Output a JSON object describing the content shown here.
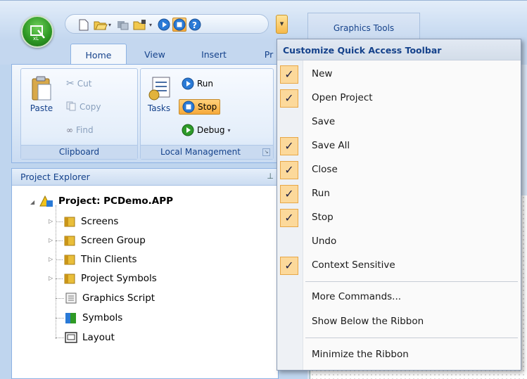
{
  "context_tab": "Graphics Tools",
  "ribbon": {
    "tabs": [
      {
        "label": "Home",
        "active": true
      },
      {
        "label": "View",
        "active": false
      },
      {
        "label": "Insert",
        "active": false
      },
      {
        "label": "Pr",
        "active": false
      }
    ],
    "clipboard": {
      "paste": "Paste",
      "cut": "Cut",
      "copy": "Copy",
      "find": "Find",
      "group_label": "Clipboard"
    },
    "local_management": {
      "tasks": "Tasks",
      "run": "Run",
      "stop": "Stop",
      "debug": "Debug",
      "group_label": "Local Management"
    }
  },
  "explorer": {
    "title": "Project Explorer",
    "root": "Project: PCDemo.APP",
    "items": [
      {
        "label": "Screens",
        "icon": "folder-icon",
        "expandable": true
      },
      {
        "label": "Screen Group",
        "icon": "folder-icon",
        "expandable": true
      },
      {
        "label": "Thin Clients",
        "icon": "folder-icon",
        "expandable": true
      },
      {
        "label": "Project Symbols",
        "icon": "folder-icon",
        "expandable": true
      },
      {
        "label": "Graphics Script",
        "icon": "script-icon",
        "expandable": false
      },
      {
        "label": "Symbols",
        "icon": "symbols-icon",
        "expandable": false
      },
      {
        "label": "Layout",
        "icon": "layout-icon",
        "expandable": false
      }
    ]
  },
  "menu": {
    "title": "Customize Quick Access Toolbar",
    "items": [
      {
        "label": "New",
        "checked": true
      },
      {
        "label": "Open Project",
        "checked": true
      },
      {
        "label": "Save",
        "checked": false
      },
      {
        "label": "Save All",
        "checked": true
      },
      {
        "label": "Close",
        "checked": true
      },
      {
        "label": "Run",
        "checked": true
      },
      {
        "label": "Stop",
        "checked": true
      },
      {
        "label": "Undo",
        "checked": false
      },
      {
        "label": "Context Sensitive",
        "checked": true
      }
    ],
    "more_commands": "More Commands...",
    "show_below": "Show Below the Ribbon",
    "minimize": "Minimize the Ribbon",
    "check_glyph": "✓"
  },
  "colors": {
    "accent": "#15428b",
    "check_bg": "#fcd99b",
    "orb_green": "#2f9a25"
  }
}
